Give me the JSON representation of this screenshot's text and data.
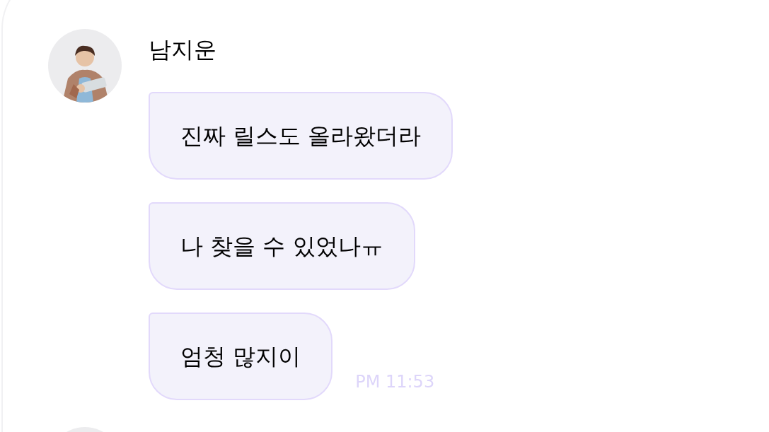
{
  "sender": {
    "name": "남지운"
  },
  "messages": [
    {
      "text": "진짜 릴스도 올라왔더라"
    },
    {
      "text": "나 찾을 수 있었나ㅠ"
    },
    {
      "text": "엄청 많지이"
    }
  ],
  "time": "PM 11:53"
}
